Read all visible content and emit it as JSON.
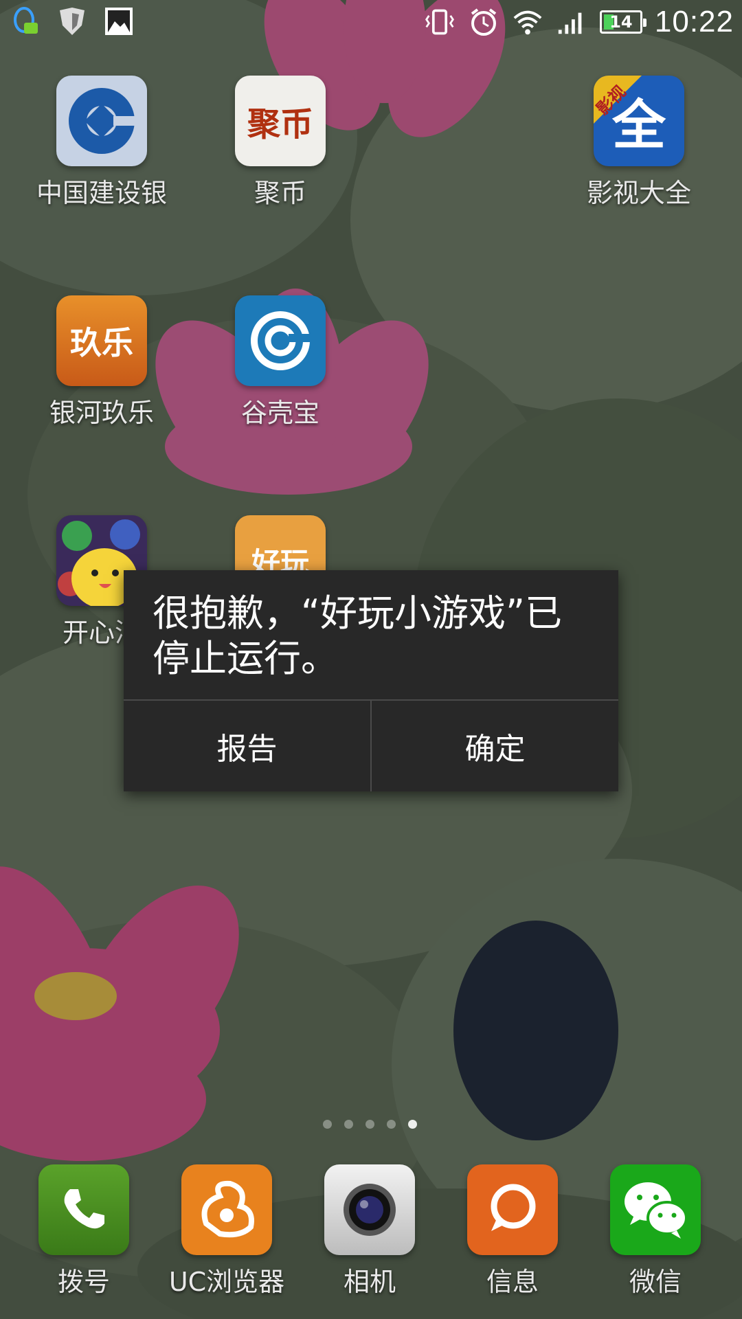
{
  "status_bar": {
    "left_icons": [
      "qq-notification-icon",
      "security-shield-icon",
      "gallery-icon"
    ],
    "right_icons": [
      "vibrate-icon",
      "alarm-icon",
      "wifi-icon",
      "signal-icon"
    ],
    "battery": "14",
    "time": "10:22"
  },
  "apps": [
    {
      "label": "中国建设银"
    },
    {
      "label": "聚币",
      "tile_text": "聚币"
    },
    {
      "label": "影视大全",
      "tile_text": "全",
      "badge": "影视"
    },
    {
      "label": "银河玖乐",
      "tile_text": "玖乐"
    },
    {
      "label": "谷壳宝"
    },
    {
      "label": "开心消"
    },
    {
      "label": "",
      "tile_text": "好玩"
    }
  ],
  "page_indicator": {
    "count": 5,
    "active": 5
  },
  "dock": [
    {
      "label": "拨号"
    },
    {
      "label": "UC浏览器"
    },
    {
      "label": "相机"
    },
    {
      "label": "信息"
    },
    {
      "label": "微信"
    }
  ],
  "dialog": {
    "message": "很抱歉，“好玩小游戏”已停止运行。",
    "report_button": "报告",
    "ok_button": "确定"
  },
  "colors": {
    "dialog_bg": "#282828",
    "wechat_green": "#1aa81a",
    "phone_green": "#4a8a1e",
    "uc_orange": "#e8821e",
    "sms_orange": "#e2641e"
  }
}
